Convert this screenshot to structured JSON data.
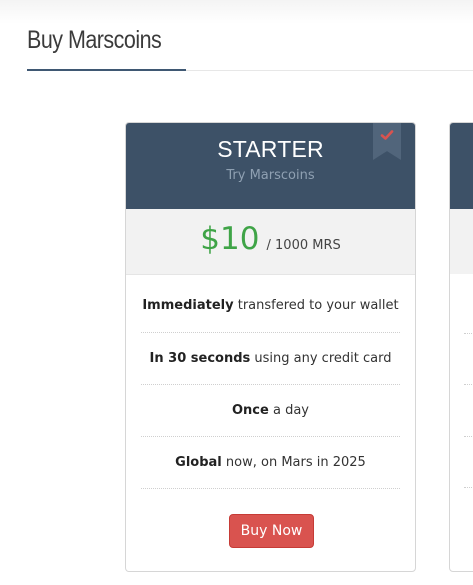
{
  "page": {
    "title": "Buy Marscoins"
  },
  "plan": {
    "name": "STARTER",
    "subtitle": "Try Marscoins",
    "badge_icon": "check-icon",
    "price": "$10",
    "unit": "/ 1000 MRS",
    "features": [
      {
        "bold": "Immediately",
        "text": " transfered to your wallet"
      },
      {
        "bold": "In 30 seconds",
        "text": " using any credit card"
      },
      {
        "bold": "Once",
        "text": " a day"
      },
      {
        "bold": "Global",
        "text": " now, on Mars in 2025"
      }
    ],
    "button_label": "Buy Now"
  },
  "colors": {
    "header": "#3d5167",
    "price": "#3fa447",
    "button": "#d9534f",
    "accent_rule": "#3f5873",
    "ribbon_check": "#d9534f"
  }
}
